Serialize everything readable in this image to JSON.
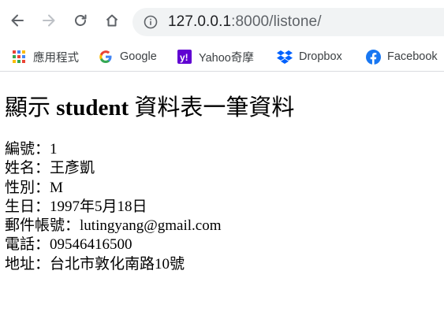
{
  "browser": {
    "url_host": "127.0.0.1",
    "url_rest": ":8000/listone/",
    "bookmarks": [
      {
        "label": "應用程式",
        "icon": "apps-grid-icon"
      },
      {
        "label": "Google",
        "icon": "google-icon"
      },
      {
        "label": "Yahoo奇摩",
        "icon": "yahoo-icon"
      },
      {
        "label": "Dropbox",
        "icon": "dropbox-icon"
      },
      {
        "label": "Facebook",
        "icon": "facebook-icon"
      }
    ]
  },
  "page": {
    "heading_pre": "顯示 ",
    "heading_bold": "student",
    "heading_post": " 資料表一筆資料",
    "fields": [
      {
        "label": "編號：",
        "value": "1"
      },
      {
        "label": "姓名：",
        "value": "王彥凱"
      },
      {
        "label": "性別：",
        "value": "M"
      },
      {
        "label": "生日：",
        "value": "1997年5月18日"
      },
      {
        "label": "郵件帳號：",
        "value": "lutingyang@gmail.com"
      },
      {
        "label": "電話：",
        "value": "09546416500"
      },
      {
        "label": "地址：",
        "value": "台北市敦化南路10號"
      }
    ]
  },
  "colors": {
    "omnibox_bg": "#f1f3f4",
    "icon_gray": "#5f6368",
    "yahoo_purple": "#6001d2",
    "dropbox_blue": "#0061fe",
    "facebook_blue": "#1877f2"
  }
}
